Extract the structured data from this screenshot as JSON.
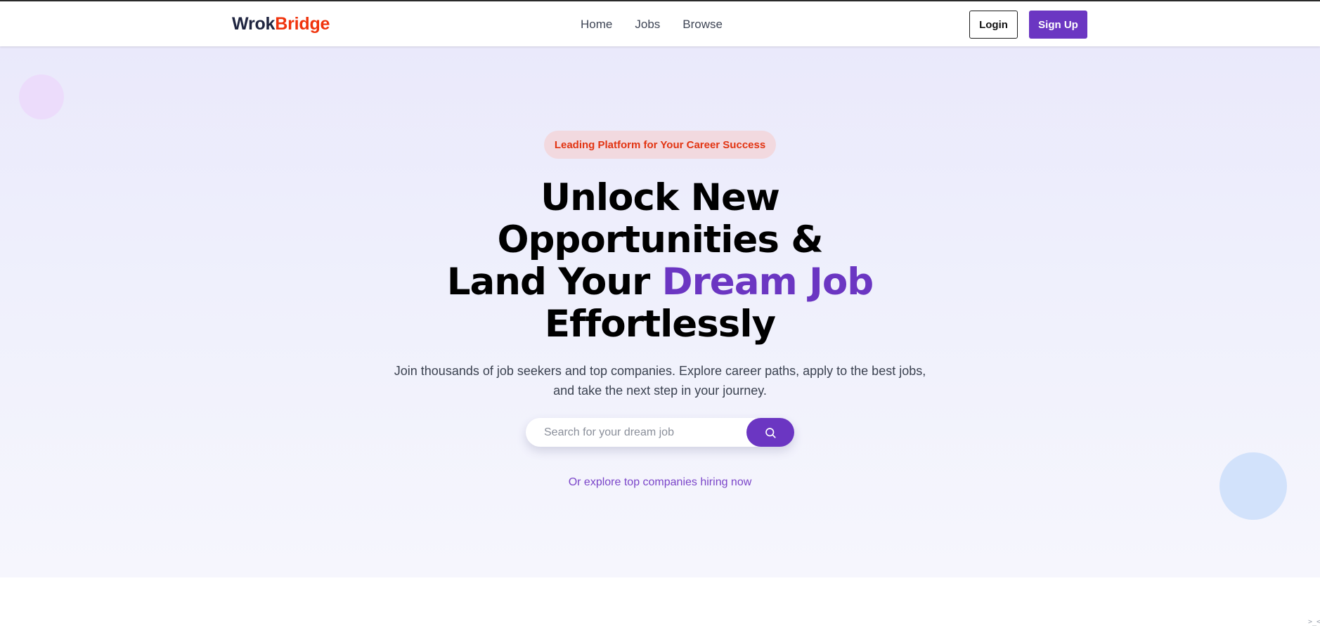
{
  "navbar": {
    "logo_part1": "Wrok",
    "logo_part2": "Bridge",
    "links": [
      {
        "label": "Home"
      },
      {
        "label": "Jobs"
      },
      {
        "label": "Browse"
      }
    ],
    "login_label": "Login",
    "signup_label": "Sign Up"
  },
  "hero": {
    "badge": "Leading Platform for Your Career Success",
    "headline_line1": "Unlock New",
    "headline_line2": "Opportunities &",
    "headline_line3_prefix": "Land Your ",
    "headline_accent": "Dream Job",
    "headline_line4": "Effortlessly",
    "subtext_line1": "Join thousands of job seekers and top companies. Explore career paths, apply to the best jobs,",
    "subtext_line2": "and take the next step in your journey.",
    "search": {
      "placeholder": "Search for your dream job",
      "button_icon": "search-icon"
    },
    "explore_link": "Or explore top companies hiring now"
  },
  "colors": {
    "brand_purple": "#6b36c2",
    "logo_dark": "#1f2540",
    "logo_accent": "#f0330c",
    "badge_text": "#e23412",
    "badge_bg": "#f2d9df"
  },
  "icons": {
    "corner": ">_<"
  }
}
